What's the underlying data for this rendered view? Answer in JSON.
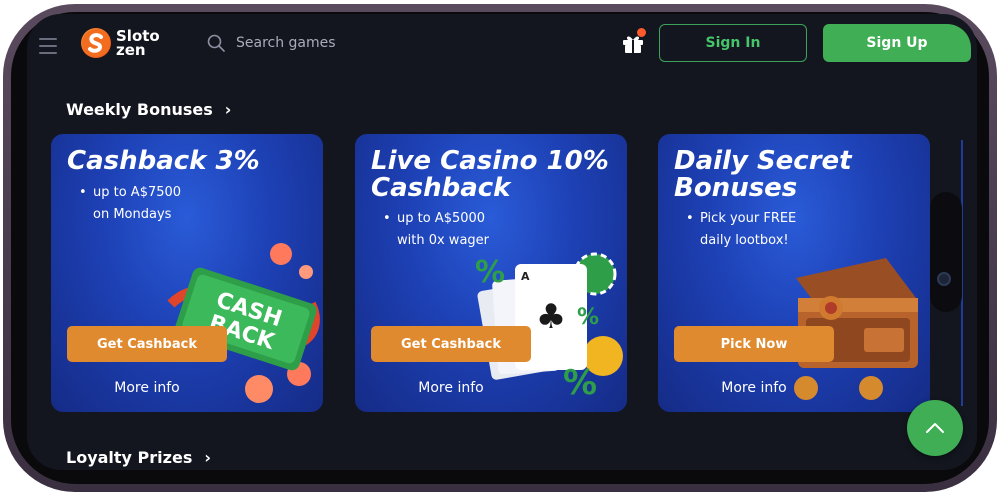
{
  "header": {
    "logo_line1": "Sloto",
    "logo_line2": "zen",
    "search_placeholder": "Search games",
    "signin_label": "Sign In",
    "signup_label": "Sign Up"
  },
  "sections": {
    "weekly_title": "Weekly Bonuses",
    "loyalty_title": "Loyalty Prizes"
  },
  "cards": [
    {
      "title": "Cashback 3%",
      "bullet": "•",
      "desc_line1": "up to A$7500",
      "desc_line2": "on Mondays",
      "button": "Get Cashback",
      "more": "More info",
      "art_text1": "CASH",
      "art_text2": "BACK"
    },
    {
      "title": "Live Casino 10% Cashback",
      "bullet": "•",
      "desc_line1": "up to A$5000",
      "desc_line2": "with 0x wager",
      "button": "Get Cashback",
      "more": "More info"
    },
    {
      "title": "Daily Secret Bonuses",
      "bullet": "•",
      "desc_line1": "Pick your FREE",
      "desc_line2": "daily lootbox!",
      "button": "Pick Now",
      "more": "More info"
    }
  ],
  "icons": {
    "search": "search-icon",
    "gift": "gift-icon",
    "menu": "menu-icon",
    "chevron": "chevron-right-icon",
    "scroll_top": "chevron-up-icon"
  },
  "colors": {
    "accent_green": "#3fae54",
    "button_orange": "#e08a2f",
    "card_blue": "#1d40b4",
    "background": "#13161f"
  }
}
